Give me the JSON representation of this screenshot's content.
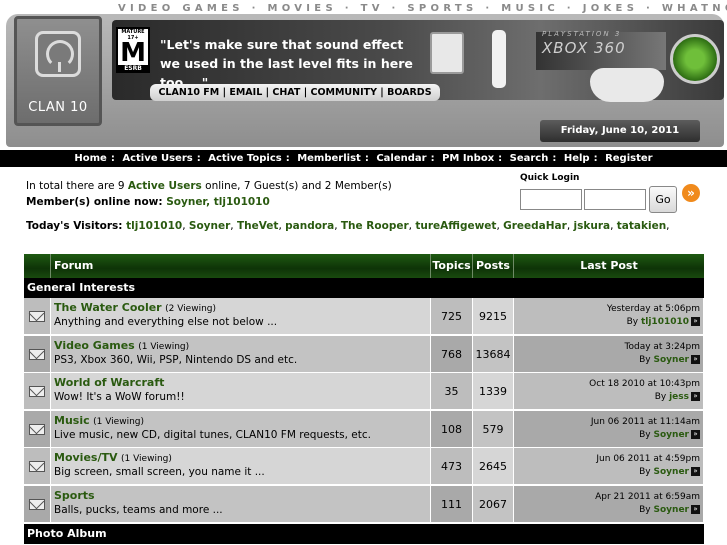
{
  "header": {
    "categories": "VIDEO GAMES  ·  MOVIES  ·  TV  ·  SPORTS  ·  MUSIC  ·  JOKES  ·  WHATNOT",
    "logo_text": "CLAN 10",
    "quote": "\"Let's make sure that sound effect we used in the last level fits in here too ...\"",
    "esrb": {
      "top": "MATURE 17+",
      "letter": "M",
      "bottom": "ESRB"
    },
    "xbox_label": "XBOX 360",
    "ps3_label": "PLAYSTATION 3",
    "top_links": [
      "CLAN10 FM",
      "EMAIL",
      "CHAT",
      "COMMUNITY",
      "BOARDS"
    ],
    "date": "Friday, June 10, 2011"
  },
  "mainnav": [
    "Home",
    "Active Users",
    "Active Topics",
    "Memberlist",
    "Calendar",
    "PM Inbox",
    "Search",
    "Help",
    "Register"
  ],
  "online": {
    "prefix": "In total there are 9 ",
    "active_users_link": "Active Users",
    "suffix": " online, 7 Guest(s) and 2 Member(s)",
    "members_label": "Member(s) online now: ",
    "members": [
      "Soyner",
      "tlj101010"
    ]
  },
  "quick_login": {
    "label": "Quick Login",
    "go_label": "Go"
  },
  "visitors": {
    "label": "Today's Visitors: ",
    "names": [
      "tlj101010",
      "Soyner",
      "TheVet",
      "pandora",
      "The Rooper",
      "tureAffigewet",
      "GreedaHar",
      "jskura",
      "tatakien"
    ]
  },
  "table": {
    "headers": {
      "forum": "Forum",
      "topics": "Topics",
      "posts": "Posts",
      "last_post": "Last Post"
    },
    "categories": [
      "General Interests",
      "Photo Album"
    ],
    "by_label": "By",
    "rows": [
      {
        "title": "The Water Cooler",
        "viewing": "(2 Viewing)",
        "desc": "Anything and everything else not below ...",
        "topics": "725",
        "posts": "9215",
        "last_date": "Yesterday at 5:06pm",
        "last_user": "tlj101010"
      },
      {
        "title": "Video Games",
        "viewing": "(1 Viewing)",
        "desc": "PS3, Xbox 360, Wii, PSP, Nintendo DS and etc.",
        "topics": "768",
        "posts": "13684",
        "last_date": "Today at 3:24pm",
        "last_user": "Soyner"
      },
      {
        "title": "World of Warcraft",
        "viewing": "",
        "desc": "Wow! It's a WoW forum!!",
        "topics": "35",
        "posts": "1339",
        "last_date": "Oct 18 2010 at 10:43pm",
        "last_user": "jess"
      },
      {
        "title": "Music",
        "viewing": "(1 Viewing)",
        "desc": "Live music, new CD, digital tunes, CLAN10 FM requests, etc.",
        "topics": "108",
        "posts": "579",
        "last_date": "Jun 06 2011 at 11:14am",
        "last_user": "Soyner"
      },
      {
        "title": "Movies/TV",
        "viewing": "(1 Viewing)",
        "desc": "Big screen, small screen, you name it ...",
        "topics": "473",
        "posts": "2645",
        "last_date": "Jun 06 2011 at 4:59pm",
        "last_user": "Soyner"
      },
      {
        "title": "Sports",
        "viewing": "",
        "desc": "Balls, pucks, teams and more ...",
        "topics": "111",
        "posts": "2067",
        "last_date": "Apr 21 2011 at 6:59am",
        "last_user": "Soyner"
      }
    ]
  }
}
